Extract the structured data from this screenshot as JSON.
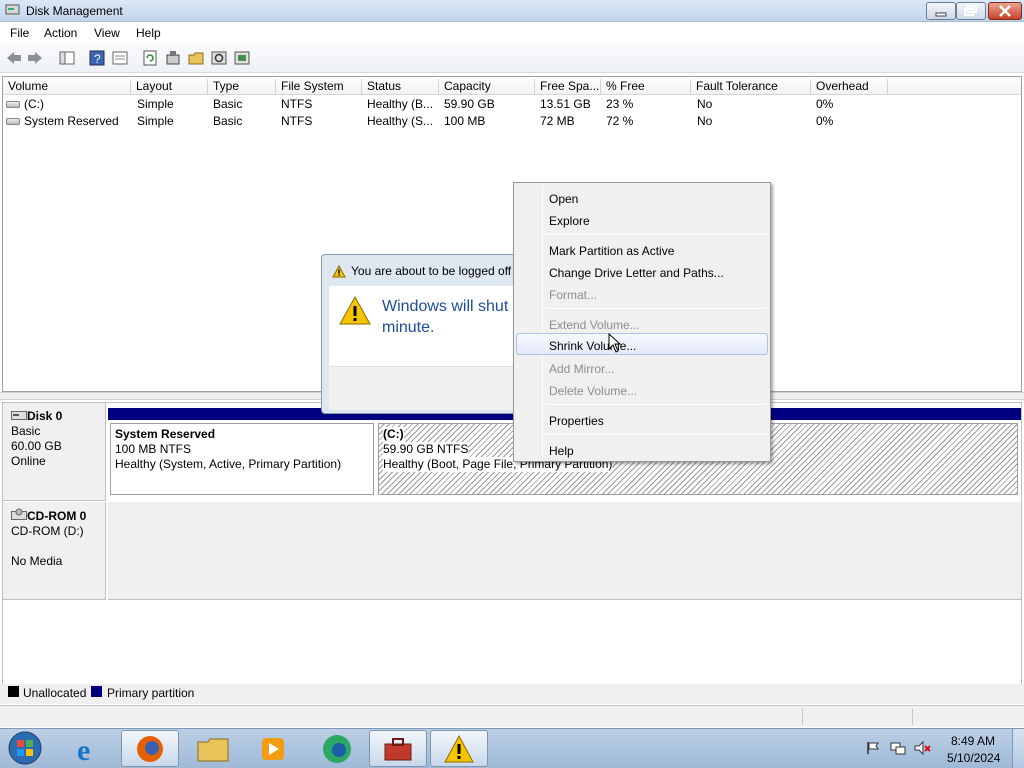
{
  "window": {
    "title": "Disk Management"
  },
  "menu": [
    "File",
    "Action",
    "View",
    "Help"
  ],
  "toolbar": {
    "icons": [
      "back-icon",
      "forward-icon",
      "show-hide-console-tree-icon",
      "help-icon",
      "properties-icon",
      "refresh-icon",
      "rescan-icon",
      "open-icon",
      "search-icon",
      "export-icon"
    ]
  },
  "volume_table": {
    "columns": [
      "Volume",
      "Layout",
      "Type",
      "File System",
      "Status",
      "Capacity",
      "Free Spa...",
      "% Free",
      "Fault Tolerance",
      "Overhead"
    ],
    "rows": [
      [
        "(C:)",
        "Simple",
        "Basic",
        "NTFS",
        "Healthy (B...",
        "59.90 GB",
        "13.51 GB",
        "23 %",
        "No",
        "0%"
      ],
      [
        "System Reserved",
        "Simple",
        "Basic",
        "NTFS",
        "Healthy (S...",
        "100 MB",
        "72 MB",
        "72 %",
        "No",
        "0%"
      ]
    ]
  },
  "disks": [
    {
      "name": "Disk 0",
      "type": "Basic",
      "size": "60.00 GB",
      "state": "Online",
      "partitions": [
        {
          "name": "System Reserved",
          "size": "100 MB NTFS",
          "status": "Healthy (System, Active, Primary Partition)"
        },
        {
          "name": "(C:)",
          "size": "59.90 GB NTFS",
          "status": "Healthy (Boot, Page File, Primary Partition)"
        }
      ]
    },
    {
      "name": "CD-ROM 0",
      "type": "CD-ROM (D:)",
      "state": "No Media"
    }
  ],
  "legend": [
    "Unallocated",
    "Primary partition"
  ],
  "legend_colors": {
    "unallocated": "#000000",
    "primary": "#000080"
  },
  "dialog": {
    "title": "You are about to be logged off",
    "message_line1": "Windows will shut",
    "message_line2": "minute."
  },
  "context_menu": {
    "items": [
      {
        "label": "Open",
        "enabled": true
      },
      {
        "label": "Explore",
        "enabled": true
      },
      {
        "label": "Mark Partition as Active",
        "enabled": true
      },
      {
        "label": "Change Drive Letter and Paths...",
        "enabled": true
      },
      {
        "label": "Format...",
        "enabled": false
      },
      {
        "label": "Extend Volume...",
        "enabled": false
      },
      {
        "label": "Shrink Volume...",
        "enabled": true,
        "highlighted": true
      },
      {
        "label": "Add Mirror...",
        "enabled": false
      },
      {
        "label": "Delete Volume...",
        "enabled": false
      },
      {
        "label": "Properties",
        "enabled": true
      },
      {
        "label": "Help",
        "enabled": true
      }
    ]
  },
  "taskbar": {
    "apps": [
      "internet-explorer-icon",
      "firefox-icon",
      "file-explorer-icon",
      "media-player-icon",
      "edge-icon",
      "toolbox-icon",
      "warning-icon"
    ],
    "time": "8:49 AM",
    "date": "5/10/2024"
  }
}
